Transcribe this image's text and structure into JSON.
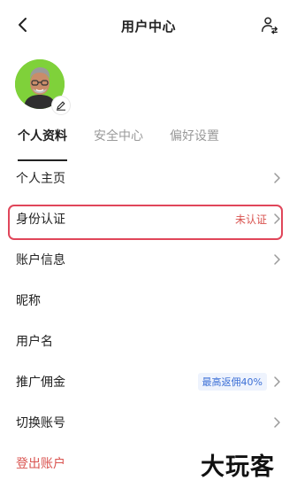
{
  "header": {
    "title": "用户中心",
    "back_icon": "chevron-left-icon",
    "switch_icon": "user-switch-icon"
  },
  "profile": {
    "avatar_icon": "avatar",
    "edit_icon": "pencil-icon"
  },
  "tabs": [
    {
      "label": "个人资料",
      "active": true
    },
    {
      "label": "安全中心",
      "active": false
    },
    {
      "label": "偏好设置",
      "active": false
    }
  ],
  "rows": [
    {
      "label": "个人主页"
    },
    {
      "label": "身份认证",
      "status": "未认证"
    },
    {
      "label": "账户信息"
    },
    {
      "label": "昵称"
    },
    {
      "label": "用户名"
    },
    {
      "label": "推广佣金",
      "badge": "最高返佣40%"
    },
    {
      "label": "切换账号"
    },
    {
      "label": "登出账户"
    }
  ],
  "colors": {
    "accent_red": "#d9534f",
    "highlight_border": "#e0465a",
    "promo_blue": "#3b6fd6",
    "avatar_bg": "#7fd13a"
  },
  "watermark": "大玩客"
}
